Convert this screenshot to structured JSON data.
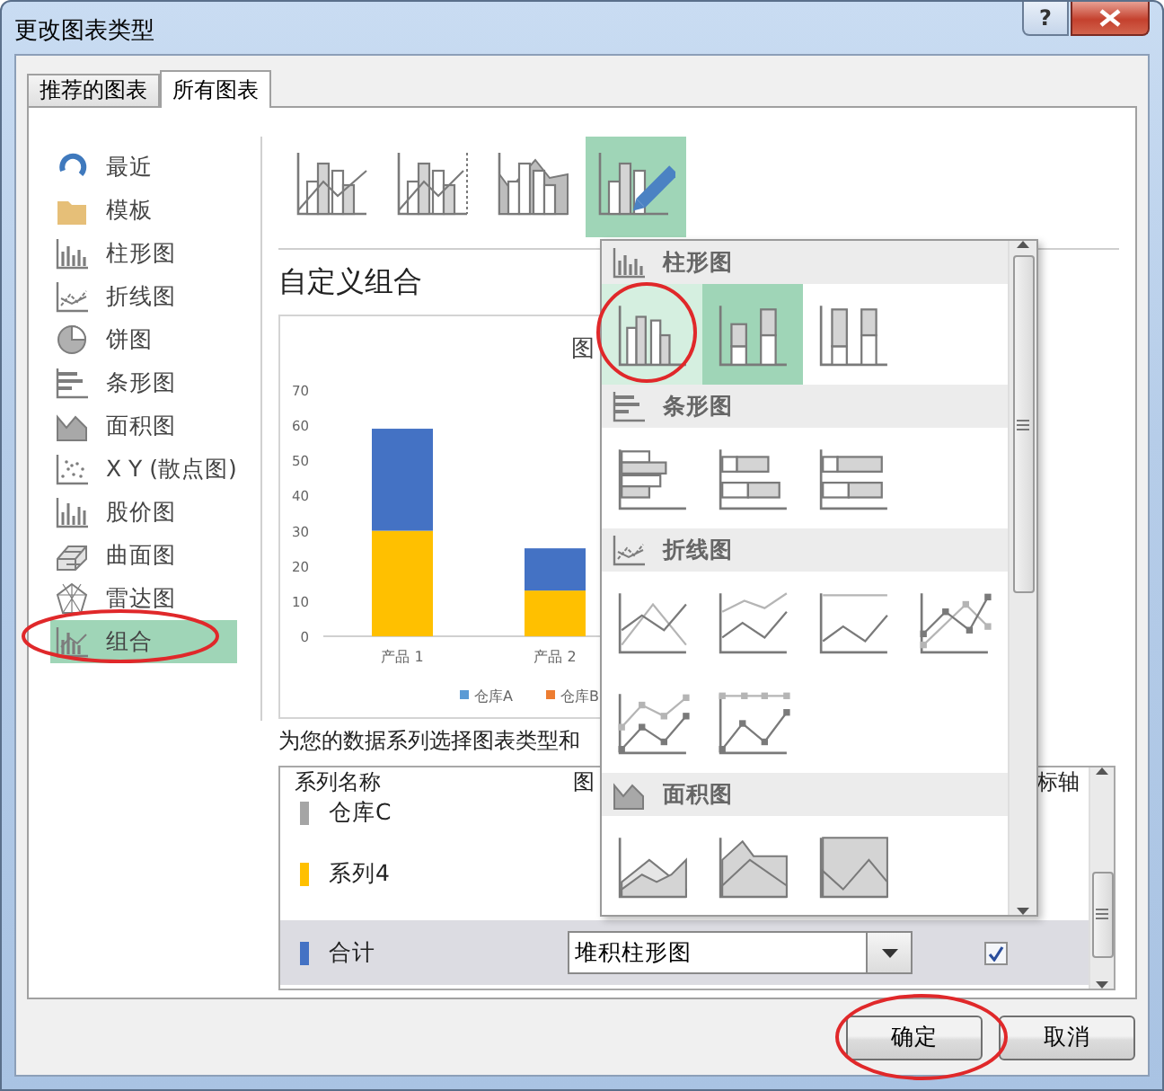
{
  "window": {
    "title": "更改图表类型"
  },
  "title_buttons": [
    {
      "kind": "help",
      "label": "?"
    },
    {
      "kind": "close"
    }
  ],
  "tabs": [
    {
      "label": "推荐的图表",
      "selected": false
    },
    {
      "label": "所有图表",
      "selected": true
    }
  ],
  "sidebar": {
    "items": [
      {
        "kind": "recent",
        "label": "最近",
        "selected": false
      },
      {
        "kind": "template",
        "label": "模板",
        "selected": false
      },
      {
        "kind": "column",
        "label": "柱形图",
        "selected": false
      },
      {
        "kind": "line",
        "label": "折线图",
        "selected": false
      },
      {
        "kind": "pie",
        "label": "饼图",
        "selected": false
      },
      {
        "kind": "bar",
        "label": "条形图",
        "selected": false
      },
      {
        "kind": "area",
        "label": "面积图",
        "selected": false
      },
      {
        "kind": "scatter",
        "label": "X Y (散点图)",
        "selected": false
      },
      {
        "kind": "stock",
        "label": "股价图",
        "selected": false
      },
      {
        "kind": "surface",
        "label": "曲面图",
        "selected": false
      },
      {
        "kind": "radar",
        "label": "雷达图",
        "selected": false
      },
      {
        "kind": "combo",
        "label": "组合",
        "selected": true
      }
    ]
  },
  "subtypes": [
    {
      "kind": "combo-column-line",
      "selected": false
    },
    {
      "kind": "combo-secondary-line",
      "selected": false
    },
    {
      "kind": "combo-area-column",
      "selected": false
    },
    {
      "kind": "custom",
      "selected": true
    }
  ],
  "heading": "自定义组合",
  "preview": {
    "title": "图",
    "chart_data": {
      "type": "bar",
      "stacked": true,
      "categories": [
        "产品 1",
        "产品 2"
      ],
      "ylim": [
        0,
        70
      ],
      "yticks": [
        0,
        10,
        20,
        30,
        40,
        50,
        60,
        70
      ],
      "series": [
        {
          "color": "#ffc000",
          "values": [
            30,
            13
          ]
        },
        {
          "color": "#4472c4",
          "values": [
            29,
            12
          ]
        }
      ]
    },
    "legend": [
      {
        "label": "仓库A",
        "color": "#5b9bd5"
      },
      {
        "label": "仓库B",
        "color": "#ed7d31"
      }
    ]
  },
  "series_prompt": "为您的数据系列选择图表类型和",
  "series_table": {
    "columns": [
      "系列名称",
      "图",
      "标轴"
    ],
    "rows": [
      {
        "name": "仓库C",
        "color": "#a5a5a5",
        "selected": false
      },
      {
        "name": "系列4",
        "color": "#ffc000",
        "selected": false
      },
      {
        "name": "合计",
        "color": "#4472c4",
        "selected": true,
        "chart_type": "堆积柱形图",
        "secondary_axis": true
      }
    ]
  },
  "type_menu": {
    "groups": [
      {
        "kind": "column",
        "label": "柱形图",
        "items": [
          {
            "kind": "clustered-column",
            "selected": false,
            "hovered": true
          },
          {
            "kind": "stacked-column",
            "selected": true,
            "hovered": false
          },
          {
            "kind": "percent-column",
            "selected": false,
            "hovered": false
          }
        ]
      },
      {
        "kind": "bar",
        "label": "条形图",
        "items": [
          {
            "kind": "clustered-bar",
            "selected": false,
            "hovered": false
          },
          {
            "kind": "stacked-bar",
            "selected": false,
            "hovered": false
          },
          {
            "kind": "percent-bar",
            "selected": false,
            "hovered": false
          }
        ]
      },
      {
        "kind": "line",
        "label": "折线图",
        "items": [
          {
            "kind": "line",
            "selected": false,
            "hovered": false
          },
          {
            "kind": "stacked-line",
            "selected": false,
            "hovered": false
          },
          {
            "kind": "percent-line",
            "selected": false,
            "hovered": false
          },
          {
            "kind": "line-markers",
            "selected": false,
            "hovered": false
          },
          {
            "kind": "stacked-line-markers",
            "selected": false,
            "hovered": false
          },
          {
            "kind": "percent-line-markers",
            "selected": false,
            "hovered": false
          }
        ]
      },
      {
        "kind": "area",
        "label": "面积图",
        "items": [
          {
            "kind": "area",
            "selected": false,
            "hovered": false
          },
          {
            "kind": "stacked-area",
            "selected": false,
            "hovered": false
          },
          {
            "kind": "percent-area",
            "selected": false,
            "hovered": false
          }
        ]
      }
    ]
  },
  "buttons": [
    {
      "label": "确定"
    },
    {
      "label": "取消"
    }
  ]
}
